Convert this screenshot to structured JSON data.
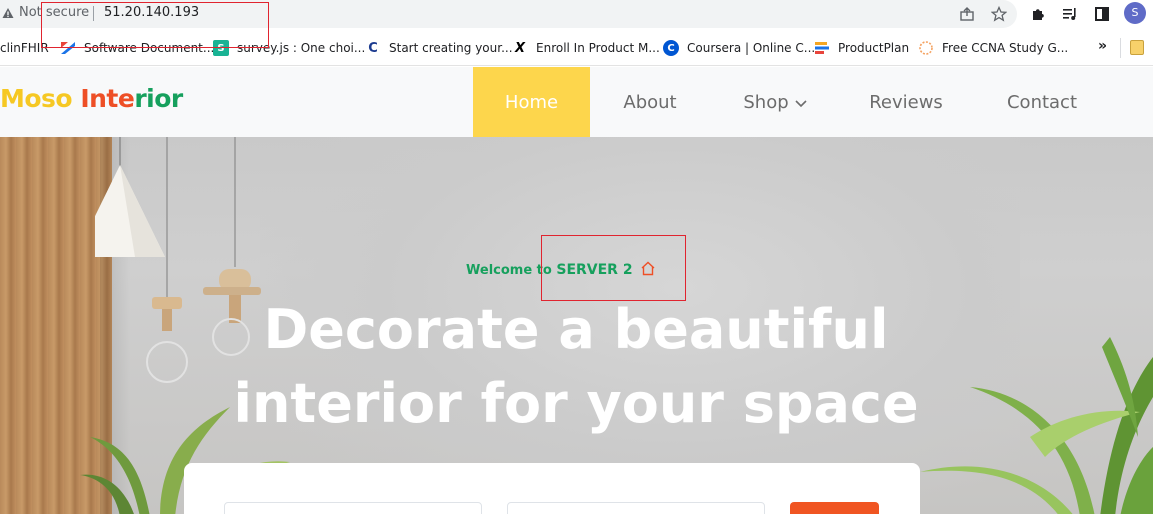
{
  "browser": {
    "security_label": "Not secure",
    "url": "51.20.140.193",
    "profile_initial": "S",
    "icons": {
      "security": "warning-triangle-icon",
      "share": "share-icon",
      "bookmark": "star-icon",
      "extensions": "puzzle-icon",
      "media": "media-queue-icon",
      "side_panel": "side-panel-icon"
    }
  },
  "bookmarks": [
    {
      "label": "clinFHIR",
      "color": "#5f6368",
      "glyph": ""
    },
    {
      "label": "Software Document...",
      "color": "#1a73e8",
      "glyph": ""
    },
    {
      "label": "survey.js : One choi...",
      "color": "#19b394",
      "glyph": "S"
    },
    {
      "label": "Start creating your...",
      "color": "#1b3a8f",
      "glyph": "C"
    },
    {
      "label": "Enroll In Product M...",
      "color": "#000000",
      "glyph": "X"
    },
    {
      "label": "Coursera | Online C...",
      "color": "#0056d2",
      "glyph": "C"
    },
    {
      "label": "ProductPlan",
      "color": "#f5a623",
      "glyph": ""
    },
    {
      "label": "Free CCNA Study G...",
      "color": "#f4a261",
      "glyph": ""
    }
  ],
  "site": {
    "logo_word1": "Moso",
    "logo_word2_part1": "Inte",
    "logo_word2_part2": "rior",
    "nav": {
      "home": "Home",
      "about": "About",
      "shop": "Shop",
      "reviews": "Reviews",
      "contact": "Contact"
    },
    "hero": {
      "welcome_prefix": "Welcome to",
      "server_name": "SERVER 2",
      "title_line1": "Decorate a beautiful",
      "title_line2": "interior for your space"
    }
  },
  "colors": {
    "brand_yellow": "#fdd64c",
    "brand_green": "#16a05d",
    "brand_orange": "#f05522",
    "annotation_red": "#e0242f"
  }
}
